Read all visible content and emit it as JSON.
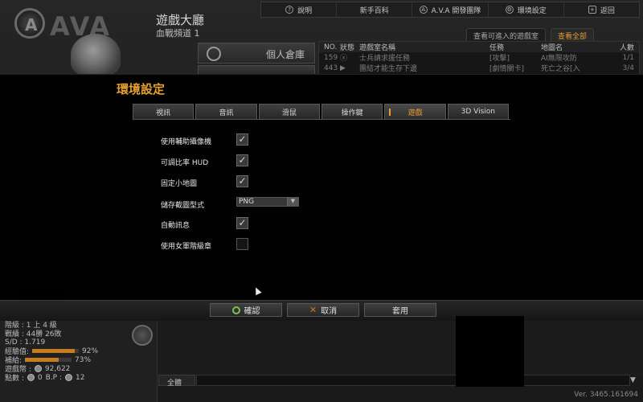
{
  "lobby": {
    "logo_text": "AVA",
    "logo_mark": "A",
    "title": "遊戲大廳",
    "channel": "血戰頻道  1",
    "topbar": [
      {
        "label": "說明",
        "icon": "help-icon"
      },
      {
        "label": "新手百科",
        "icon": ""
      },
      {
        "label": "A.V.A 開發團隊",
        "icon": "team-icon"
      },
      {
        "label": "環境設定",
        "icon": "gear-icon"
      },
      {
        "label": "返回",
        "icon": "exit-icon"
      }
    ],
    "room_filter_tabs": [
      {
        "label": "查看可進入的遊戲室"
      },
      {
        "label": "查看全部"
      }
    ],
    "side_button": "個人倉庫",
    "room_list": {
      "headers": {
        "no": "NO.",
        "status": "狀態",
        "name": "遊戲室名稱",
        "task": "任務",
        "map": "地圖名",
        "players": "人數"
      },
      "rows": [
        {
          "no": "159",
          "name": "士兵請求援任務",
          "task": "[攻擊]",
          "map": "AI無限攻防",
          "players": "1/1"
        },
        {
          "no": "443",
          "name": "團結才能生存下邊",
          "task": "[劇情關卡]",
          "map": "死亡之谷[入",
          "players": "3/4"
        }
      ]
    }
  },
  "dialog": {
    "title": "環境設定",
    "tabs": [
      {
        "label": "視訊"
      },
      {
        "label": "音訊"
      },
      {
        "label": "滑鼠"
      },
      {
        "label": "操作鍵"
      },
      {
        "label": "遊戲"
      },
      {
        "label": "3D Vision"
      }
    ],
    "options": [
      {
        "label": "使用輔助攝像機",
        "checked": true
      },
      {
        "label": "可調比率 HUD",
        "checked": true
      },
      {
        "label": "固定小地圖",
        "checked": true
      },
      {
        "label": "自動訊息",
        "checked": true
      },
      {
        "label": "使用女軍階級章",
        "checked": false
      }
    ],
    "screenshot_format": {
      "label": "儲存截圖型式",
      "value": "PNG"
    },
    "buttons": {
      "confirm": "確認",
      "cancel": "取消",
      "apply": "套用"
    },
    "check_glyph": "✓"
  },
  "stats": {
    "rank_label": "階級 : 1 上 4 級",
    "record": "戰績 : 44勝 26敗",
    "sd": "S/D : 1.719",
    "exp_label": "經驗值:",
    "exp_value": "92%",
    "exp_fraction": 0.92,
    "supply_label": "補給:",
    "supply_value": "73%",
    "supply_fraction": 0.73,
    "euro_label": "遊戲幣 :",
    "euro_value": "92,622",
    "points_label": "點數 :",
    "points_value": "0",
    "bp_label": "B.P :",
    "bp_value": "12"
  },
  "chat": {
    "tab": "全體"
  },
  "version": "Ver. 3465.161694",
  "colors": {
    "accent": "#e7a030",
    "confirm_green": "#7fc24c",
    "cancel_orange": "#d2762a",
    "bar_fill": "#c97c1e"
  }
}
